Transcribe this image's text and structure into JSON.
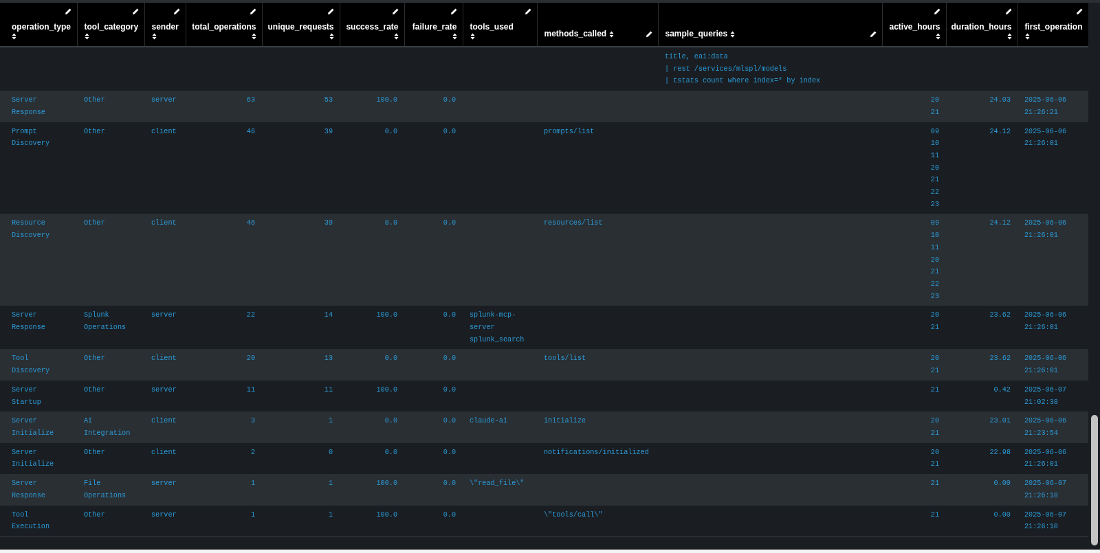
{
  "table": {
    "columns": [
      {
        "label": "operation_type",
        "numeric": false,
        "kind": "stacked"
      },
      {
        "label": "tool_category",
        "numeric": false,
        "kind": "stacked"
      },
      {
        "label": "sender",
        "numeric": false,
        "kind": "stacked"
      },
      {
        "label": "total_operations",
        "numeric": true,
        "kind": "stacked"
      },
      {
        "label": "unique_requests",
        "numeric": true,
        "kind": "stacked"
      },
      {
        "label": "success_rate",
        "numeric": true,
        "kind": "stacked"
      },
      {
        "label": "failure_rate",
        "numeric": true,
        "kind": "stacked"
      },
      {
        "label": "tools_used",
        "numeric": false,
        "kind": "stacked"
      },
      {
        "label": "methods_called",
        "numeric": false,
        "kind": "inline"
      },
      {
        "label": "sample_queries",
        "numeric": false,
        "kind": "inline"
      },
      {
        "label": "active_hours",
        "numeric": true,
        "kind": "stacked"
      },
      {
        "label": "duration_hours",
        "numeric": true,
        "kind": "stacked"
      },
      {
        "label": "first_operation",
        "numeric": false,
        "kind": "stacked"
      }
    ],
    "rows": [
      {
        "sample_queries": [
          "title, eai:data",
          "| rest /services/mlspl/models",
          "| tstats count where index=* by index"
        ]
      },
      {
        "operation_type": "Server Response",
        "tool_category": "Other",
        "sender": "server",
        "total_operations": "63",
        "unique_requests": "53",
        "success_rate": "100.0",
        "failure_rate": "0.0",
        "active_hours": [
          "20",
          "21"
        ],
        "duration_hours": "24.03",
        "first_operation": "2025-06-06 21:26:21"
      },
      {
        "operation_type": "Prompt Discovery",
        "tool_category": "Other",
        "sender": "client",
        "total_operations": "46",
        "unique_requests": "39",
        "success_rate": "0.0",
        "failure_rate": "0.0",
        "methods_called": "prompts/list",
        "active_hours": [
          "09",
          "10",
          "11",
          "20",
          "21",
          "22",
          "23"
        ],
        "duration_hours": "24.12",
        "first_operation": "2025-06-06 21:26:01"
      },
      {
        "operation_type": "Resource Discovery",
        "tool_category": "Other",
        "sender": "client",
        "total_operations": "46",
        "unique_requests": "39",
        "success_rate": "0.0",
        "failure_rate": "0.0",
        "methods_called": "resources/list",
        "active_hours": [
          "09",
          "10",
          "11",
          "20",
          "21",
          "22",
          "23"
        ],
        "duration_hours": "24.12",
        "first_operation": "2025-06-06 21:26:01"
      },
      {
        "operation_type": "Server Response",
        "tool_category": "Splunk Operations",
        "sender": "server",
        "total_operations": "22",
        "unique_requests": "14",
        "success_rate": "100.0",
        "failure_rate": "0.0",
        "tools_used": [
          "splunk-mcp-server",
          "splunk_search"
        ],
        "active_hours": [
          "20",
          "21"
        ],
        "duration_hours": "23.62",
        "first_operation": "2025-06-06 21:26:01"
      },
      {
        "operation_type": "Tool Discovery",
        "tool_category": "Other",
        "sender": "client",
        "total_operations": "20",
        "unique_requests": "13",
        "success_rate": "0.0",
        "failure_rate": "0.0",
        "methods_called": "tools/list",
        "active_hours": [
          "20",
          "21"
        ],
        "duration_hours": "23.62",
        "first_operation": "2025-06-06 21:26:01"
      },
      {
        "operation_type": "Server Startup",
        "tool_category": "Other",
        "sender": "server",
        "total_operations": "11",
        "unique_requests": "11",
        "success_rate": "100.0",
        "failure_rate": "0.0",
        "active_hours": [
          "21"
        ],
        "duration_hours": "0.42",
        "first_operation": "2025-06-07 21:02:38"
      },
      {
        "operation_type": "Server Initialize",
        "tool_category": "AI Integration",
        "sender": "client",
        "total_operations": "3",
        "unique_requests": "1",
        "success_rate": "0.0",
        "failure_rate": "0.0",
        "tools_used": "claude-ai",
        "methods_called": "initialize",
        "active_hours": [
          "20",
          "21"
        ],
        "duration_hours": "23.01",
        "first_operation": "2025-06-06 21:23:54"
      },
      {
        "operation_type": "Server Initialize",
        "tool_category": "Other",
        "sender": "client",
        "total_operations": "2",
        "unique_requests": "0",
        "success_rate": "0.0",
        "failure_rate": "0.0",
        "methods_called": "notifications/initialized",
        "active_hours": [
          "20",
          "21"
        ],
        "duration_hours": "22.98",
        "first_operation": "2025-06-06 21:26:01"
      },
      {
        "operation_type": "Server Response",
        "tool_category": "File Operations",
        "sender": "server",
        "total_operations": "1",
        "unique_requests": "1",
        "success_rate": "100.0",
        "failure_rate": "0.0",
        "tools_used": "\\\"read_file\\\"",
        "active_hours": [
          "21"
        ],
        "duration_hours": "0.00",
        "first_operation": "2025-06-07 21:26:18"
      },
      {
        "operation_type": "Tool Execution",
        "tool_category": "Other",
        "sender": "server",
        "total_operations": "1",
        "unique_requests": "1",
        "success_rate": "100.0",
        "failure_rate": "0.0",
        "methods_called": "\\\"tools/call\\\"",
        "active_hours": [
          "21"
        ],
        "duration_hours": "0.00",
        "first_operation": "2025-06-07 21:26:10"
      }
    ]
  }
}
